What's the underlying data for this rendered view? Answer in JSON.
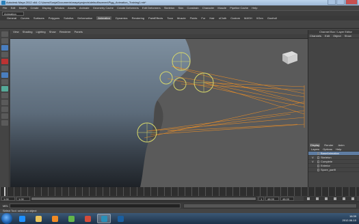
{
  "window": {
    "title": "Autodesk Maya 2012 x64: C:\\Users\\Sonja\\Documents\\maya\\projects\\default\\scenes\\Pigg_Animation_Training1.mb*"
  },
  "menubar": [
    "File",
    "Edit",
    "Modify",
    "Create",
    "Display",
    "Window",
    "Assets",
    "Animate",
    "Geometry Cache",
    "Create Deformers",
    "Edit Deformers",
    "Skeleton",
    "Skin",
    "Constrain",
    "Character",
    "Muscle",
    "Pipeline Cache",
    "Help"
  ],
  "status_line": {
    "mode": "Animation"
  },
  "shelf_tabs": [
    "General",
    "Curves",
    "Surfaces",
    "Polygons",
    "Subdivs",
    "Deformation",
    "Animation",
    "Dynamics",
    "Rendering",
    "PaintEffects",
    "Toon",
    "Muscle",
    "Fluids",
    "Fur",
    "Hair",
    "nCloth",
    "Custom",
    "MASH",
    "XGen",
    "Goofroll"
  ],
  "shelf_active_index": 6,
  "panel_menu": [
    "View",
    "Shading",
    "Lighting",
    "Show",
    "Renderer",
    "Panels"
  ],
  "channel_box": {
    "title": "Channel Box / Layer Editor",
    "menu": [
      "Channels",
      "Edit",
      "Object",
      "Show"
    ]
  },
  "layer_editor": {
    "tabs": [
      "Display",
      "Render",
      "Anim"
    ],
    "active_tab": 0,
    "menu": [
      "Layers",
      "Options",
      "Help"
    ],
    "layers": [
      {
        "visible": "",
        "name": "BaseAnimation",
        "selected": true,
        "color": "#5f7da3"
      },
      {
        "visible": "V",
        "name": "Skeleton",
        "selected": false,
        "color": "#444444"
      },
      {
        "visible": "V",
        "name": "Complete",
        "selected": false,
        "color": "#444444"
      },
      {
        "visible": "",
        "name": "Exterior",
        "selected": false,
        "color": "#444444"
      },
      {
        "visible": "",
        "name": "Spore_part9",
        "selected": false,
        "color": "#444444"
      }
    ]
  },
  "time_controls": {
    "start_time": "1.00",
    "range_start": "1.00",
    "current_time": "1",
    "range_end": "48.00",
    "end_time": "48.00",
    "anim_layer": "No Anim Layer",
    "character_set": "No Character Set"
  },
  "command_line": {
    "label": "MEL",
    "help": "Select Tool: select an object"
  },
  "taskbar": {
    "apps": [
      "start-orb",
      "ie",
      "explorer",
      "media-player",
      "utorrent",
      "chrome",
      "maya",
      "photoshop"
    ],
    "active_index": 6,
    "app_colors": [
      "#2a7fd8",
      "#1e90ff",
      "#e8c35c",
      "#f08a24",
      "#63b54a",
      "#d34b3a",
      "#2a8fb8",
      "#1a5fa0"
    ],
    "time": "16:39",
    "date": "2012-06-10"
  },
  "colors": {
    "controller": "#d9d96a",
    "joint_lines": "#e08a2a",
    "body": "#5a5a5a"
  }
}
